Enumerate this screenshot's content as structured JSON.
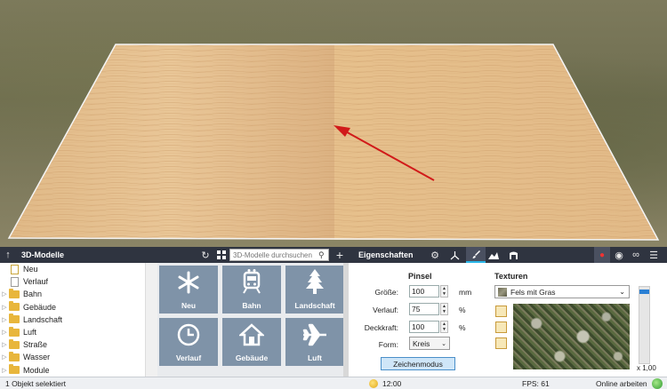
{
  "toolbar": {
    "models_title": "3D-Modelle",
    "search_placeholder": "3D-Modelle durchsuchen",
    "properties_title": "Eigenschaften"
  },
  "tree": {
    "items": [
      {
        "label": "Neu",
        "type": "file-new"
      },
      {
        "label": "Verlauf",
        "type": "file"
      },
      {
        "label": "Bahn",
        "type": "folder"
      },
      {
        "label": "Gebäude",
        "type": "folder"
      },
      {
        "label": "Landschaft",
        "type": "folder"
      },
      {
        "label": "Luft",
        "type": "folder"
      },
      {
        "label": "Straße",
        "type": "folder"
      },
      {
        "label": "Wasser",
        "type": "folder"
      },
      {
        "label": "Module",
        "type": "folder"
      }
    ]
  },
  "tiles": [
    {
      "label": "Neu",
      "icon": "asterisk-icon"
    },
    {
      "label": "Bahn",
      "icon": "train-icon"
    },
    {
      "label": "Landschaft",
      "icon": "tree-icon"
    },
    {
      "label": "Verlauf",
      "icon": "clock-icon"
    },
    {
      "label": "Gebäude",
      "icon": "house-icon"
    },
    {
      "label": "Luft",
      "icon": "airplane-icon"
    }
  ],
  "brush": {
    "title": "Pinsel",
    "size_label": "Größe:",
    "size_value": "100",
    "size_unit": "mm",
    "gradient_label": "Verlauf:",
    "gradient_value": "75",
    "gradient_unit": "%",
    "opacity_label": "Deckkraft:",
    "opacity_value": "100",
    "opacity_unit": "%",
    "shape_label": "Form:",
    "shape_value": "Kreis",
    "draw_mode_label": "Zeichenmodus"
  },
  "textures": {
    "title": "Texturen",
    "selected": "Fels mit Gras",
    "scale_label": "x 1,00",
    "scale_fraction": 0.04
  },
  "status": {
    "selection": "1 Objekt selektiert",
    "time": "12:00",
    "fps": "FPS: 61",
    "online": "Online arbeiten"
  },
  "colors": {
    "toolbar_bg": "#2f3440",
    "accent": "#29b6e8",
    "tile_bg": "#7f93a8",
    "arrow": "#d11a1a"
  }
}
